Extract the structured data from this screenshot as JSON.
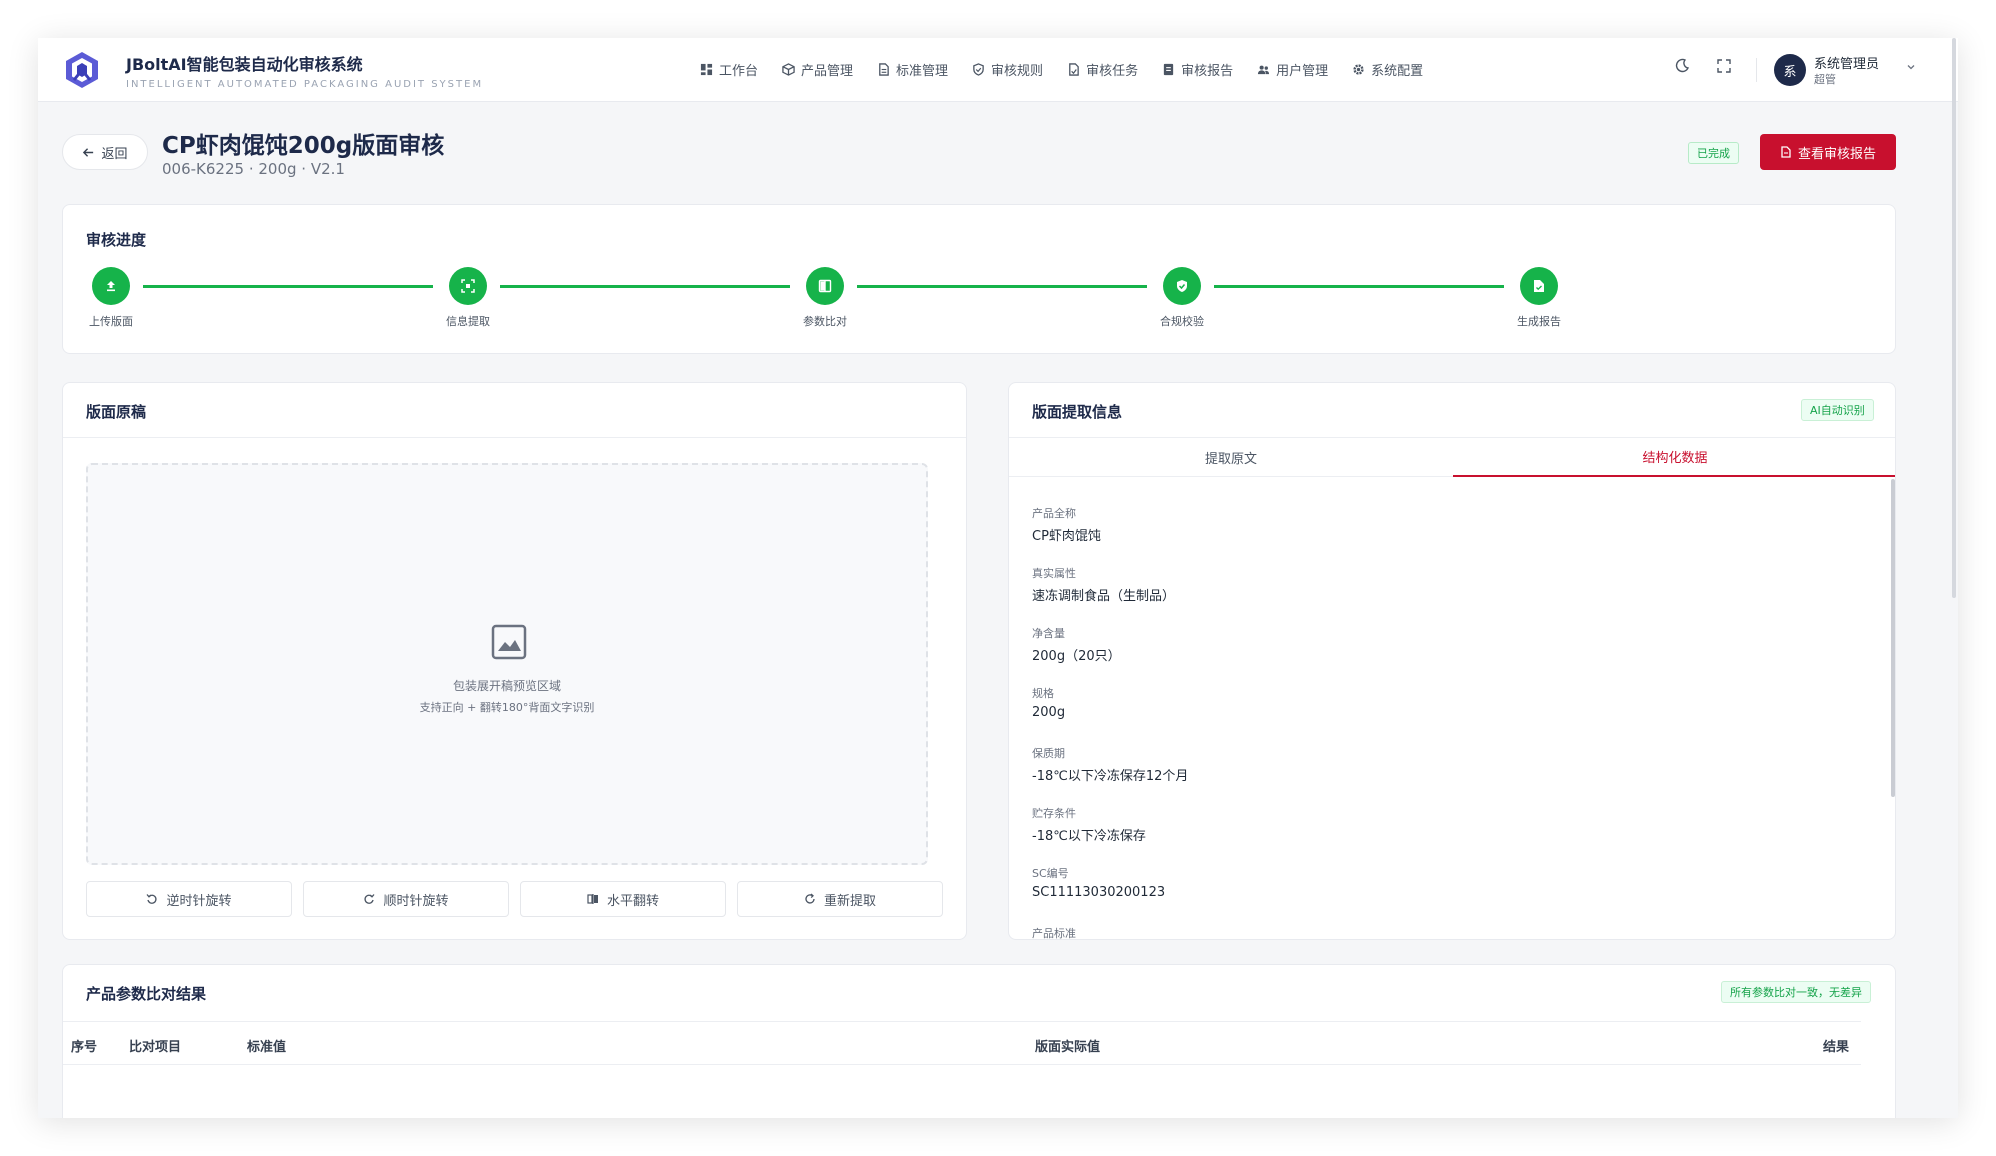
{
  "app": {
    "title": "JBoltAI智能包装自动化审核系统",
    "subtitle": "INTELLIGENT AUTOMATED PACKAGING AUDIT SYSTEM"
  },
  "nav": [
    {
      "label": "工作台",
      "icon": "dashboard-icon"
    },
    {
      "label": "产品管理",
      "icon": "box-icon"
    },
    {
      "label": "标准管理",
      "icon": "document-icon"
    },
    {
      "label": "审核规则",
      "icon": "shield-icon"
    },
    {
      "label": "审核任务",
      "icon": "task-icon"
    },
    {
      "label": "审核报告",
      "icon": "report-icon"
    },
    {
      "label": "用户管理",
      "icon": "users-icon"
    },
    {
      "label": "系统配置",
      "icon": "gear-icon"
    }
  ],
  "user": {
    "avatar": "系",
    "name": "系统管理员",
    "role": "超管"
  },
  "page": {
    "back_label": "返回",
    "title": "CP虾肉馄饨200g版面审核",
    "subtitle": "006-K6225 · 200g · V2.1",
    "status": "已完成",
    "report_button": "查看审核报告"
  },
  "progress": {
    "title": "审核进度",
    "steps": [
      {
        "label": "上传版面",
        "icon": "upload-icon"
      },
      {
        "label": "信息提取",
        "icon": "scan-icon"
      },
      {
        "label": "参数比对",
        "icon": "compare-icon"
      },
      {
        "label": "合规校验",
        "icon": "shield-check-icon"
      },
      {
        "label": "生成报告",
        "icon": "file-check-icon"
      }
    ],
    "colors": {
      "done": "#16b34a"
    }
  },
  "draft": {
    "title": "版面原稿",
    "preview_line1": "包装展开稿预览区域",
    "preview_line2": "支持正向 + 翻转180°背面文字识别",
    "tools": [
      {
        "label": "逆时针旋转",
        "icon": "rotate-ccw-icon"
      },
      {
        "label": "顺时针旋转",
        "icon": "rotate-cw-icon"
      },
      {
        "label": "水平翻转",
        "icon": "flip-horizontal-icon"
      },
      {
        "label": "重新提取",
        "icon": "refresh-icon"
      }
    ]
  },
  "extract": {
    "title": "版面提取信息",
    "badge": "AI自动识别",
    "tabs": [
      "提取原文",
      "结构化数据"
    ],
    "active_tab": "结构化数据",
    "fields": [
      {
        "label": "产品全称",
        "value": "CP虾肉馄饨"
      },
      {
        "label": "真实属性",
        "value": "速冻调制食品（生制品）"
      },
      {
        "label": "净含量",
        "value": "200g（20只）"
      },
      {
        "label": "规格",
        "value": "200g"
      },
      {
        "label": "保质期",
        "value": "-18℃以下冷冻保存12个月"
      },
      {
        "label": "贮存条件",
        "value": "-18℃以下冷冻保存"
      },
      {
        "label": "SC编号",
        "value": "SC11113030200123"
      },
      {
        "label": "产品标准",
        "value": ""
      }
    ]
  },
  "compare": {
    "title": "产品参数比对结果",
    "badge": "所有参数比对一致，无差异",
    "columns": [
      "序号",
      "比对项目",
      "标准值",
      "版面实际值",
      "结果"
    ]
  },
  "theme": {
    "accent": "#c8102e",
    "navy": "#1e2a4a",
    "success": "#16b34a"
  }
}
